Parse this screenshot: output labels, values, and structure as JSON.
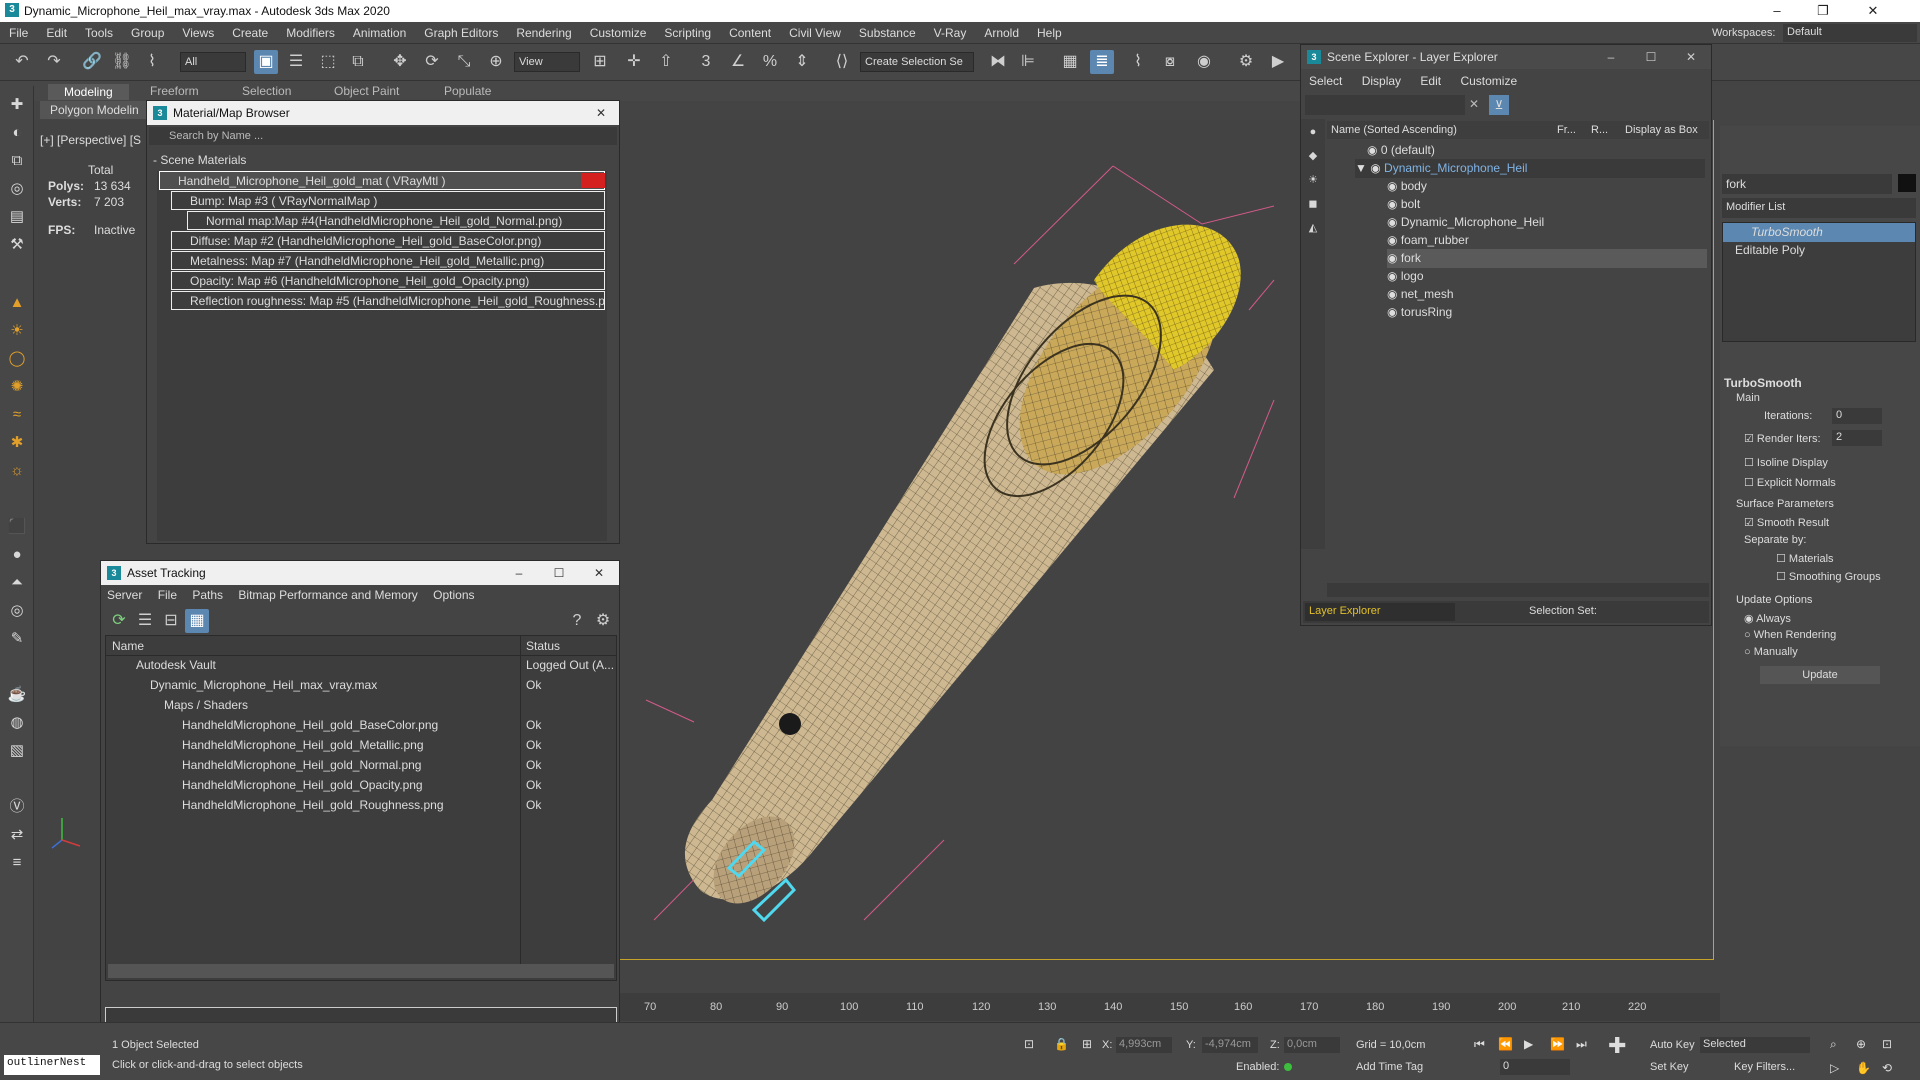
{
  "window": {
    "title": "Dynamic_Microphone_Heil_max_vray.max - Autodesk 3ds Max 2020",
    "workspace_label": "Workspaces:",
    "workspace_value": "Default"
  },
  "menu": [
    "File",
    "Edit",
    "Tools",
    "Group",
    "Views",
    "Create",
    "Modifiers",
    "Animation",
    "Graph Editors",
    "Rendering",
    "Customize",
    "Scripting",
    "Content",
    "Civil View",
    "Substance",
    "V-Ray",
    "Arnold",
    "Help"
  ],
  "toolbar": {
    "selection_filter": "All",
    "ref_coord": "View",
    "named_sel": "Create Selection Se"
  },
  "ribbon": {
    "tabs": [
      "Modeling",
      "Freeform",
      "Selection",
      "Object Paint",
      "Populate"
    ],
    "sub": "Polygon Modelin"
  },
  "viewport": {
    "label": "[+] [Perspective] [S",
    "stats": {
      "total": "Total",
      "polys_label": "Polys:",
      "polys": "13 634",
      "verts_label": "Verts:",
      "verts": "7 203",
      "fps_label": "FPS:",
      "fps": "Inactive"
    }
  },
  "material_browser": {
    "title": "Material/Map Browser",
    "search_placeholder": "Search by Name ...",
    "section": "- Scene Materials",
    "items": [
      "Handheld_Microphone_Heil_gold_mat ( VRayMtl )",
      "Bump: Map #3  ( VRayNormalMap )",
      "Normal map:Map #4(HandheldMicrophone_Heil_gold_Normal.png)",
      "Diffuse: Map #2 (HandheldMicrophone_Heil_gold_BaseColor.png)",
      "Metalness: Map #7 (HandheldMicrophone_Heil_gold_Metallic.png)",
      "Opacity: Map #6 (HandheldMicrophone_Heil_gold_Opacity.png)",
      "Reflection roughness: Map #5 (HandheldMicrophone_Heil_gold_Roughness.p..."
    ]
  },
  "asset_tracking": {
    "title": "Asset Tracking",
    "menu": [
      "Server",
      "File",
      "Paths",
      "Bitmap Performance and Memory",
      "Options"
    ],
    "col_name": "Name",
    "col_status": "Status",
    "rows": [
      {
        "name": "Autodesk Vault",
        "status": "Logged Out (A..."
      },
      {
        "name": "Dynamic_Microphone_Heil_max_vray.max",
        "status": "Ok"
      },
      {
        "name": "Maps / Shaders",
        "status": ""
      },
      {
        "name": "HandheldMicrophone_Heil_gold_BaseColor.png",
        "status": "Ok"
      },
      {
        "name": "HandheldMicrophone_Heil_gold_Metallic.png",
        "status": "Ok"
      },
      {
        "name": "HandheldMicrophone_Heil_gold_Normal.png",
        "status": "Ok"
      },
      {
        "name": "HandheldMicrophone_Heil_gold_Opacity.png",
        "status": "Ok"
      },
      {
        "name": "HandheldMicrophone_Heil_gold_Roughness.png",
        "status": "Ok"
      }
    ]
  },
  "scene_explorer": {
    "title": "Scene Explorer - Layer Explorer",
    "menu": [
      "Select",
      "Display",
      "Edit",
      "Customize"
    ],
    "col_name": "Name (Sorted Ascending)",
    "col_fr": "Fr...",
    "col_r": "R...",
    "col_box": "Display as Box",
    "rows": [
      "0 (default)",
      "Dynamic_Microphone_Heil",
      "body",
      "bolt",
      "Dynamic_Microphone_Heil",
      "foam_rubber",
      "fork",
      "logo",
      "net_mesh",
      "torusRing"
    ],
    "footer_explorer": "Layer Explorer",
    "footer_sel": "Selection Set:"
  },
  "command_panel": {
    "object_name": "fork",
    "modifier_list": "Modifier List",
    "stack": [
      "TurboSmooth",
      "Editable Poly"
    ],
    "rollout": "TurboSmooth",
    "main": "Main",
    "iterations_label": "Iterations:",
    "iterations": "0",
    "render_iters_label": "Render Iters:",
    "render_iters": "2",
    "isoline": "Isoline Display",
    "explicit": "Explicit Normals",
    "surface": "Surface Parameters",
    "smooth_result": "Smooth Result",
    "separate_by": "Separate by:",
    "materials": "Materials",
    "smoothing_groups": "Smoothing Groups",
    "update_options": "Update Options",
    "always": "Always",
    "when_rendering": "When Rendering",
    "manually": "Manually",
    "update": "Update"
  },
  "timeline": {
    "ticks": [
      "70",
      "80",
      "90",
      "100",
      "110",
      "120",
      "130",
      "140",
      "150",
      "160",
      "170",
      "180",
      "190",
      "200",
      "210",
      "220"
    ]
  },
  "status": {
    "selected": "1 Object Selected",
    "hint": "Click or click-and-drag to select objects",
    "script": "outlinerNest",
    "x_label": "X:",
    "x": "4,993cm",
    "y_label": "Y:",
    "y": "-4,974cm",
    "z_label": "Z:",
    "z": "0,0cm",
    "grid": "Grid = 10,0cm",
    "enabled": "Enabled:",
    "add_time_tag": "Add Time Tag",
    "auto_key": "Auto Key",
    "set_key": "Set Key",
    "key_sel": "Selected",
    "key_filters": "Key Filters...",
    "frame": "0"
  }
}
